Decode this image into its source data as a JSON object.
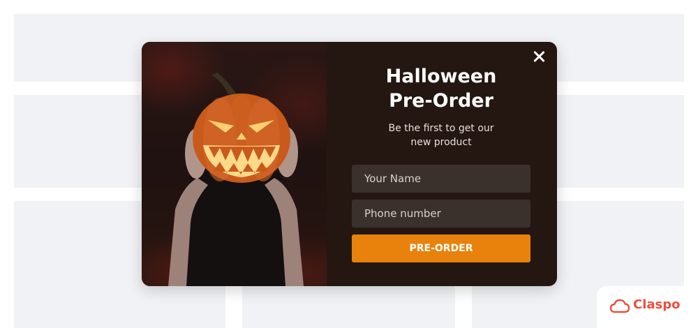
{
  "popup": {
    "title": "Halloween\nPre-Order",
    "subtitle": "Be the first to get our\nnew product",
    "name_placeholder": "Your Name",
    "phone_placeholder": "Phone number",
    "cta_label": "PRE-ORDER",
    "image_alt": "person holding carved jack-o'-lantern",
    "colors": {
      "background": "#241712",
      "accent": "#e8820c",
      "input": "#3a302c"
    }
  },
  "branding": {
    "name": "Claspo",
    "icon": "cloud-icon",
    "color": "#e8513c"
  }
}
